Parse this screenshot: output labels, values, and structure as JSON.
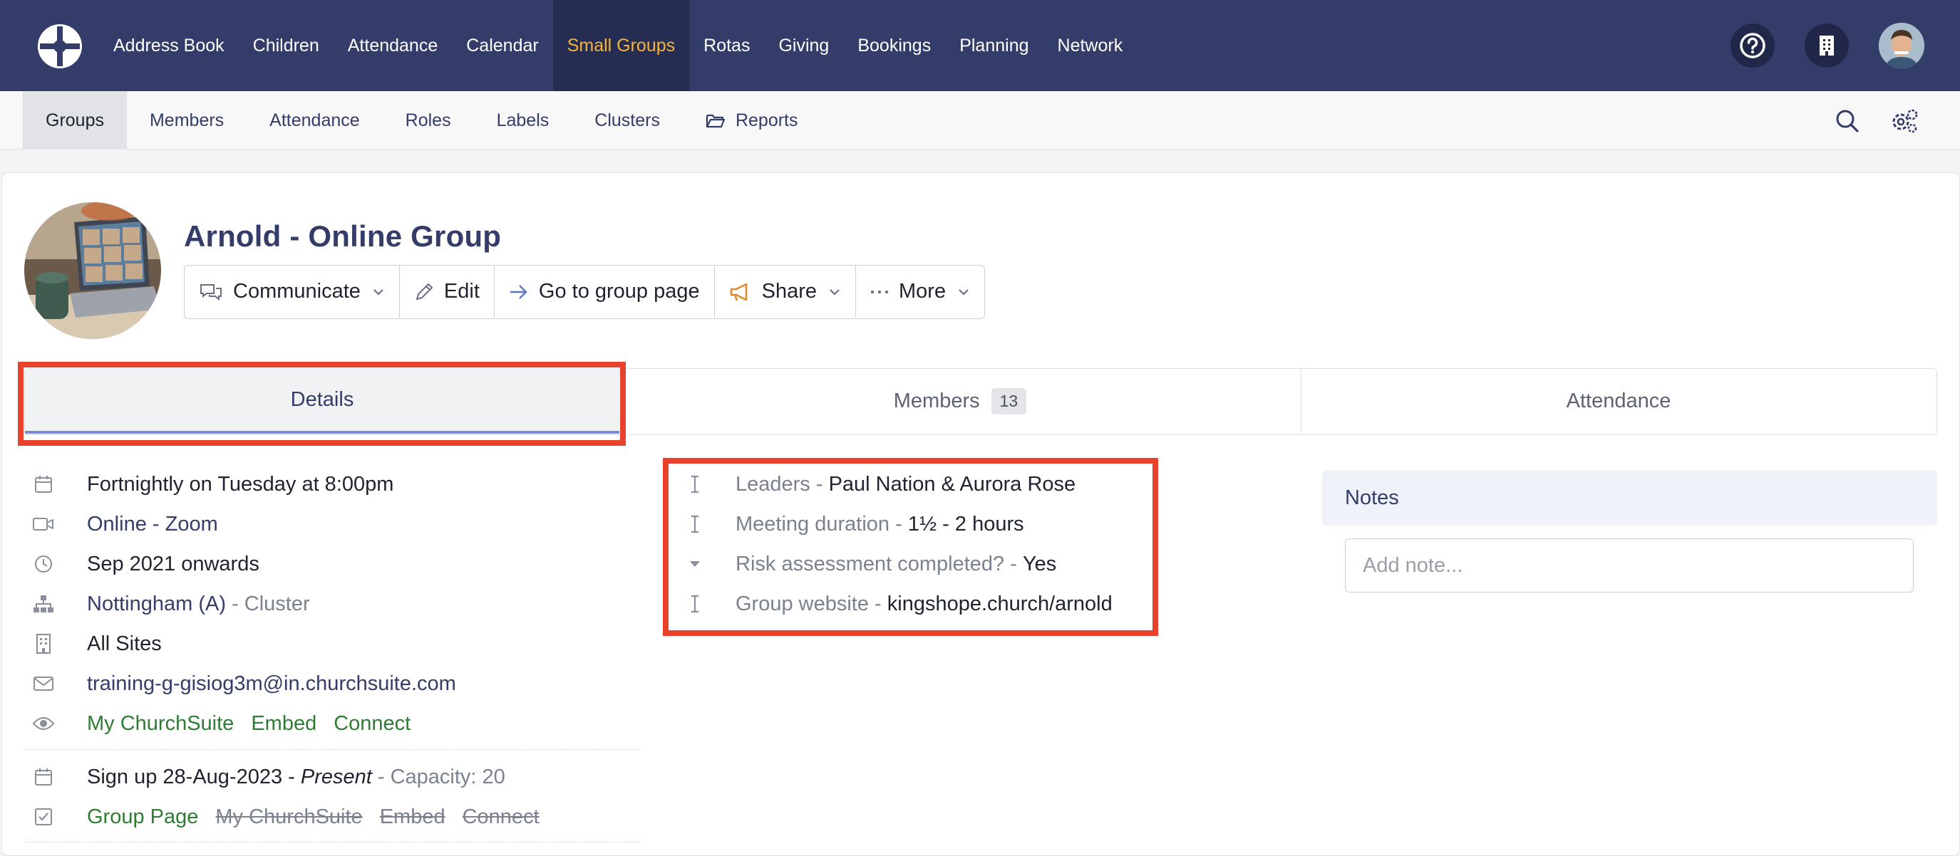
{
  "nav": {
    "items": [
      {
        "label": "Address Book"
      },
      {
        "label": "Children"
      },
      {
        "label": "Attendance"
      },
      {
        "label": "Calendar"
      },
      {
        "label": "Small Groups"
      },
      {
        "label": "Rotas"
      },
      {
        "label": "Giving"
      },
      {
        "label": "Bookings"
      },
      {
        "label": "Planning"
      },
      {
        "label": "Network"
      }
    ],
    "active": "Small Groups",
    "icons": [
      "logo-icon",
      "help-icon",
      "building-icon",
      "user-avatar"
    ]
  },
  "subnav": {
    "items": [
      {
        "label": "Groups"
      },
      {
        "label": "Members"
      },
      {
        "label": "Attendance"
      },
      {
        "label": "Roles"
      },
      {
        "label": "Labels"
      },
      {
        "label": "Clusters"
      },
      {
        "label": "Reports"
      }
    ],
    "active": "Groups",
    "icons": [
      "search-icon",
      "settings-icon"
    ]
  },
  "group": {
    "title": "Arnold - Online Group"
  },
  "actions": {
    "communicate": "Communicate",
    "edit": "Edit",
    "go_to_page": "Go to group page",
    "share": "Share",
    "more": "More"
  },
  "tabs": {
    "details": "Details",
    "members": "Members",
    "members_count": "13",
    "attendance": "Attendance"
  },
  "details": {
    "schedule": "Fortnightly on Tuesday at 8:00pm",
    "location": "Online - Zoom",
    "dates": "Sep 2021 onwards",
    "cluster_name": "Nottingham (A)",
    "cluster_suffix": " - Cluster",
    "site": "All Sites",
    "email": "training-g-gisiog3m@in.churchsuite.com",
    "visibility": [
      "My ChurchSuite",
      "Embed",
      "Connect"
    ],
    "signup_prefix": "Sign up 28-Aug-2023 - ",
    "signup_present": "Present",
    "signup_capacity": " - Capacity: 20",
    "signup_group_page": "Group Page",
    "signup_struck": [
      "My ChurchSuite",
      "Embed",
      "Connect"
    ]
  },
  "custom_fields": [
    {
      "label": "Leaders - ",
      "value": "Paul Nation & Aurora Rose"
    },
    {
      "label": "Meeting duration - ",
      "value": "1½ - 2 hours"
    },
    {
      "label": "Risk assessment completed? - ",
      "value": "Yes"
    },
    {
      "label": "Group website - ",
      "value": "kingshope.church/arnold"
    }
  ],
  "notes": {
    "title": "Notes",
    "placeholder": "Add note..."
  },
  "colors": {
    "nav_bg": "#343c6a",
    "nav_active_text": "#f5b53a",
    "highlight": "#e8412c",
    "green": "#2e7d32"
  }
}
